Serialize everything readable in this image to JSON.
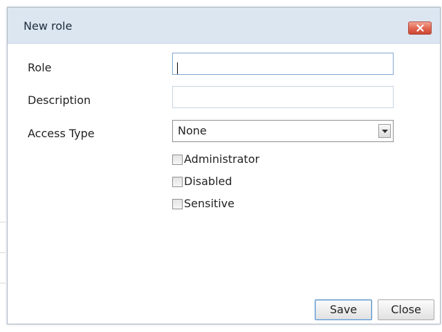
{
  "dialog": {
    "title": "New role",
    "close_icon": "close-x-icon"
  },
  "form": {
    "role": {
      "label": "Role",
      "value": "",
      "placeholder": ""
    },
    "description": {
      "label": "Description",
      "value": "",
      "placeholder": ""
    },
    "access_type": {
      "label": "Access Type",
      "selected": "None",
      "arrow_icon": "chevron-down-icon"
    },
    "checkboxes": [
      {
        "label": "Administrator",
        "checked": false
      },
      {
        "label": "Disabled",
        "checked": false
      },
      {
        "label": "Sensitive",
        "checked": false
      }
    ]
  },
  "buttons": {
    "save_label": "Save",
    "close_label": "Close"
  }
}
